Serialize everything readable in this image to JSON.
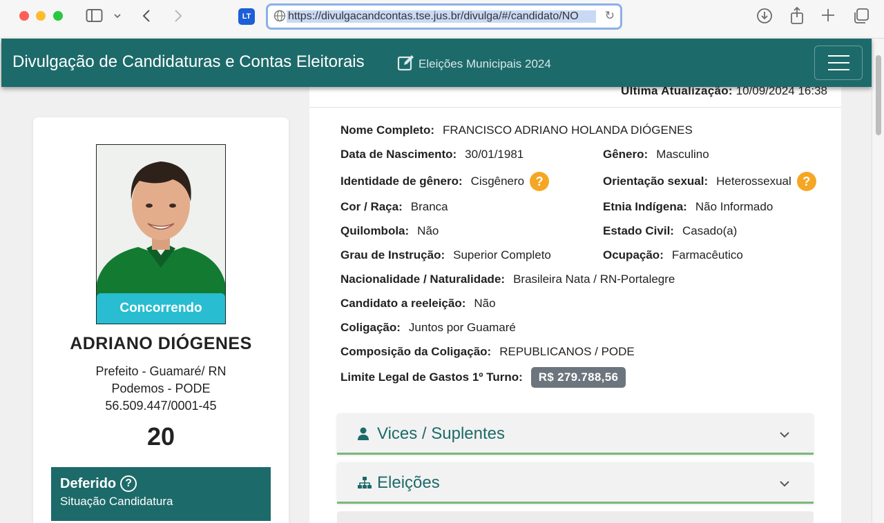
{
  "browser": {
    "url": "https://divulgacandcontas.tse.jus.br/divulga/#/candidato/NO",
    "ext_label": "LT"
  },
  "header": {
    "title": "Divulgação de Candidaturas e Contas Eleitorais",
    "subtitle": "Eleições Municipais 2024"
  },
  "update": {
    "label": "Última Atualização:",
    "value": "10/09/2024 16:38"
  },
  "candidate": {
    "status_pill": "Concorrendo",
    "name": "ADRIANO DIÓGENES",
    "office": "Prefeito - Guamaré/ RN",
    "party": "Podemos - PODE",
    "cnpj": "56.509.447/0001-45",
    "number": "20",
    "situation": "Deferido",
    "situation_label": "Situação Candidatura"
  },
  "fields": {
    "nome_completo": {
      "label": "Nome Completo:",
      "value": "FRANCISCO ADRIANO HOLANDA DIÓGENES"
    },
    "nascimento": {
      "label": "Data de Nascimento:",
      "value": "30/01/1981"
    },
    "genero": {
      "label": "Gênero:",
      "value": "Masculino"
    },
    "identidade": {
      "label": "Identidade de gênero:",
      "value": "Cisgênero"
    },
    "orientacao": {
      "label": "Orientação sexual:",
      "value": "Heterossexual"
    },
    "cor": {
      "label": "Cor / Raça:",
      "value": "Branca"
    },
    "etnia": {
      "label": "Etnia Indígena:",
      "value": "Não Informado"
    },
    "quilombola": {
      "label": "Quilombola:",
      "value": "Não"
    },
    "estado_civil": {
      "label": "Estado Civil:",
      "value": "Casado(a)"
    },
    "instrucao": {
      "label": "Grau de Instrução:",
      "value": "Superior Completo"
    },
    "ocupacao": {
      "label": "Ocupação:",
      "value": "Farmacêutico"
    },
    "nacionalidade": {
      "label": "Nacionalidade / Naturalidade:",
      "value": "Brasileira Nata / RN-Portalegre"
    },
    "reeleicao": {
      "label": "Candidato a reeleição:",
      "value": "Não"
    },
    "coligacao": {
      "label": "Coligação:",
      "value": "Juntos por Guamaré"
    },
    "composicao": {
      "label": "Composição da Coligação:",
      "value": "REPUBLICANOS / PODE"
    },
    "limite": {
      "label": "Limite Legal de Gastos 1º Turno:",
      "value": "R$ 279.788,56"
    }
  },
  "help_glyph": "?",
  "accordions": [
    {
      "title": "Vices / Suplentes",
      "icon": "user-icon"
    },
    {
      "title": "Eleições",
      "icon": "sitemap-icon"
    }
  ],
  "colors": {
    "header_bg": "#1d6a6a",
    "status_pill": "#28bdd0",
    "help_badge": "#f5a623",
    "money_badge": "#6c757d",
    "accordion_border": "#7ab77a"
  }
}
